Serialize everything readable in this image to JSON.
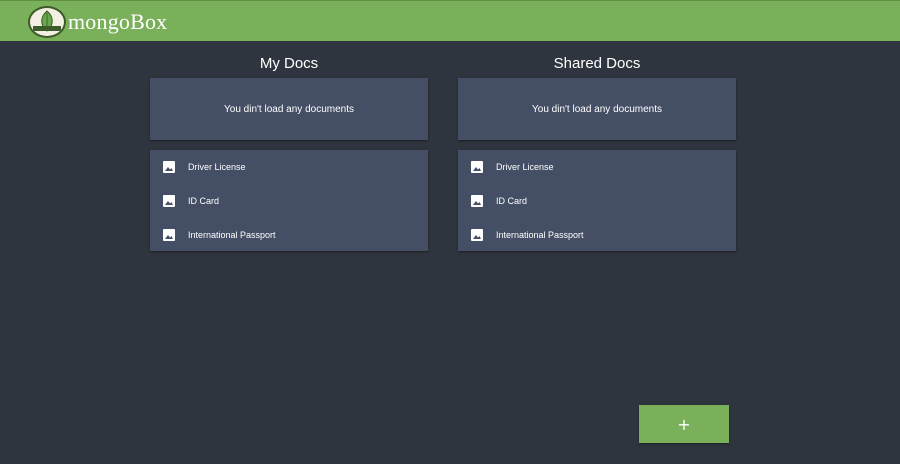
{
  "app": {
    "brand": "mongoBox",
    "logo_icon": "leaf-logo-icon",
    "accent_color": "#7ab05a",
    "background_color": "#2f353e",
    "card_color": "#444f66"
  },
  "my_docs": {
    "title": "My Docs",
    "empty_message": "You din't load any documents",
    "items": [
      {
        "label": "Driver License",
        "icon": "image-icon"
      },
      {
        "label": "ID Card",
        "icon": "image-icon"
      },
      {
        "label": "International Passport",
        "icon": "image-icon"
      }
    ]
  },
  "shared_docs": {
    "title": "Shared Docs",
    "empty_message": "You din't load any documents",
    "items": [
      {
        "label": "Driver License",
        "icon": "image-icon"
      },
      {
        "label": "ID Card",
        "icon": "image-icon"
      },
      {
        "label": "International Passport",
        "icon": "image-icon"
      }
    ]
  },
  "fab": {
    "label": "+",
    "icon": "plus-icon"
  }
}
